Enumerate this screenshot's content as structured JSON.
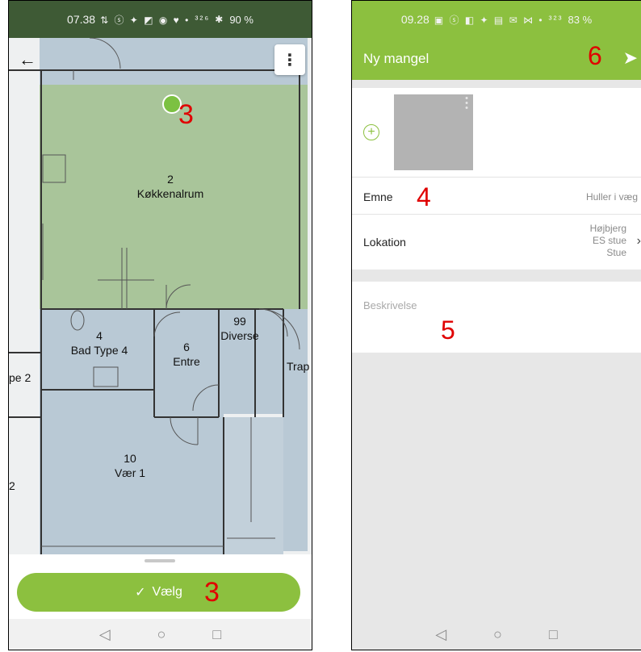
{
  "left_screen": {
    "status": {
      "time": "07.38",
      "icons": "⇅ ⓢ ✦ ◩ ◉ ♥ •",
      "network": "³²⁶",
      "bluetooth": "✱",
      "battery": "90 %"
    },
    "back_icon": "arrow-left-icon",
    "menu_icon": "more-vert-icon",
    "rooms": {
      "kitchen_num": "2",
      "kitchen_name": "Køkkenalrum",
      "bath_num": "4",
      "bath_name": "Bad Type 4",
      "entre_num": "6",
      "entre_name": "Entre",
      "diverse_num": "99",
      "diverse_name": "Diverse",
      "trap_name": "Trap",
      "room10_num": "10",
      "room10_name": "Vær 1",
      "edge_left_a": "pe 2",
      "edge_left_b": "2"
    },
    "annotation_pin": "3",
    "annotation_button": "3",
    "choose_button": {
      "icon": "✓",
      "label": "Vælg"
    },
    "nav": {
      "back": "◁",
      "home": "○",
      "recent": "□"
    }
  },
  "right_screen": {
    "status": {
      "time": "09.28",
      "icons": "▣ ⓢ ◧ ✦ ▤ ✉ ⋈ •",
      "network": "³²³",
      "battery": "83 %"
    },
    "appbar": {
      "title": "Ny mangel",
      "send_icon": "➤"
    },
    "annotation_send": "6",
    "add_photo_icon": "+",
    "subject": {
      "label": "Emne",
      "value": "Huller i væg"
    },
    "annotation_subject": "4",
    "location": {
      "label": "Lokation",
      "line1": "Højbjerg",
      "line2": "ES stue",
      "line3": "Stue"
    },
    "description": {
      "placeholder": "Beskrivelse"
    },
    "annotation_description": "5",
    "nav": {
      "back": "◁",
      "home": "○",
      "recent": "□"
    }
  }
}
